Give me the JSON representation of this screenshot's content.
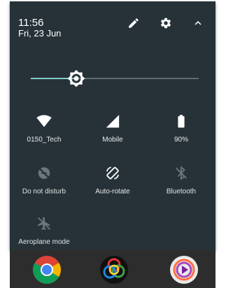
{
  "status": {
    "time": "11:56",
    "date": "Fri, 23 Jun"
  },
  "header_icons": [
    "edit-pencil-icon",
    "settings-gear-icon",
    "collapse-chevron-up-icon"
  ],
  "brightness": {
    "level": 0.27
  },
  "tiles": [
    {
      "id": "wifi",
      "label": "0150_Tech",
      "icon": "wifi-icon",
      "active": true
    },
    {
      "id": "mobile",
      "label": "Mobile",
      "icon": "cellular-signal-icon",
      "active": true
    },
    {
      "id": "battery",
      "label": "90%",
      "icon": "battery-icon",
      "active": true
    },
    {
      "id": "dnd",
      "label": "Do not disturb",
      "icon": "do-not-disturb-icon",
      "active": false
    },
    {
      "id": "rotate",
      "label": "Auto-rotate",
      "icon": "auto-rotate-icon",
      "active": true
    },
    {
      "id": "bluetooth",
      "label": "Bluetooth",
      "icon": "bluetooth-icon",
      "active": false
    },
    {
      "id": "aeroplane",
      "label": "Aeroplane mode",
      "icon": "aeroplane-icon",
      "active": false
    }
  ],
  "dock": [
    "chrome-app-icon",
    "camera-app-icon",
    "video-player-app-icon"
  ],
  "colors": {
    "panel_bg": "#263238",
    "accent": "#80cbc4",
    "dock_bg": "#2d2d2d"
  }
}
